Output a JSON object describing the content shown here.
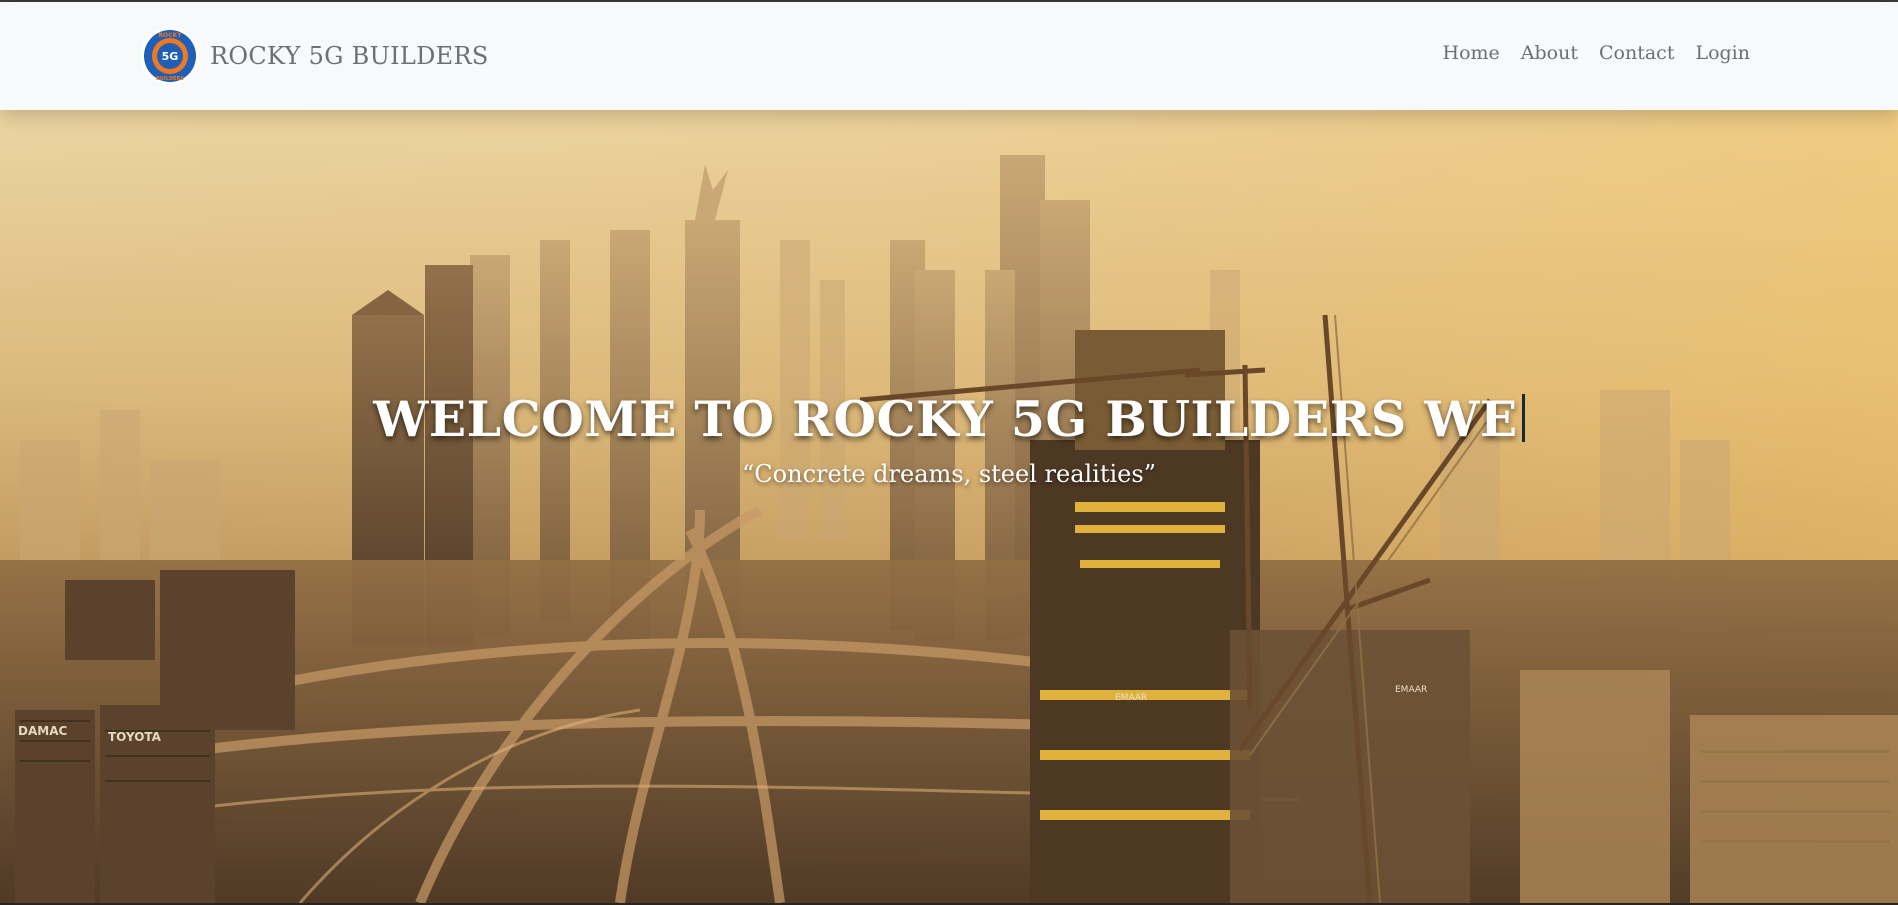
{
  "brand": {
    "name": "ROCKY 5G BUILDERS",
    "logo_top_text": "ROCKY",
    "logo_center_text": "5G",
    "logo_bottom_text": "BUILDERS"
  },
  "nav": {
    "items": [
      {
        "label": "Home"
      },
      {
        "label": "About"
      },
      {
        "label": "Contact"
      },
      {
        "label": "Login"
      }
    ]
  },
  "hero": {
    "title": "WELCOME TO ROCKY 5G BUILDERS WE",
    "tagline": "“Concrete dreams, steel realities”",
    "signage": [
      "DAMAC",
      "TOYOTA",
      "EMAAR",
      "EMAAR"
    ]
  },
  "colors": {
    "navbar_bg": "#f8f9fb",
    "nav_text": "#6b6f76",
    "logo_ring": "#1f5fb5",
    "logo_accent": "#f07820",
    "hero_text": "#ffffff"
  }
}
